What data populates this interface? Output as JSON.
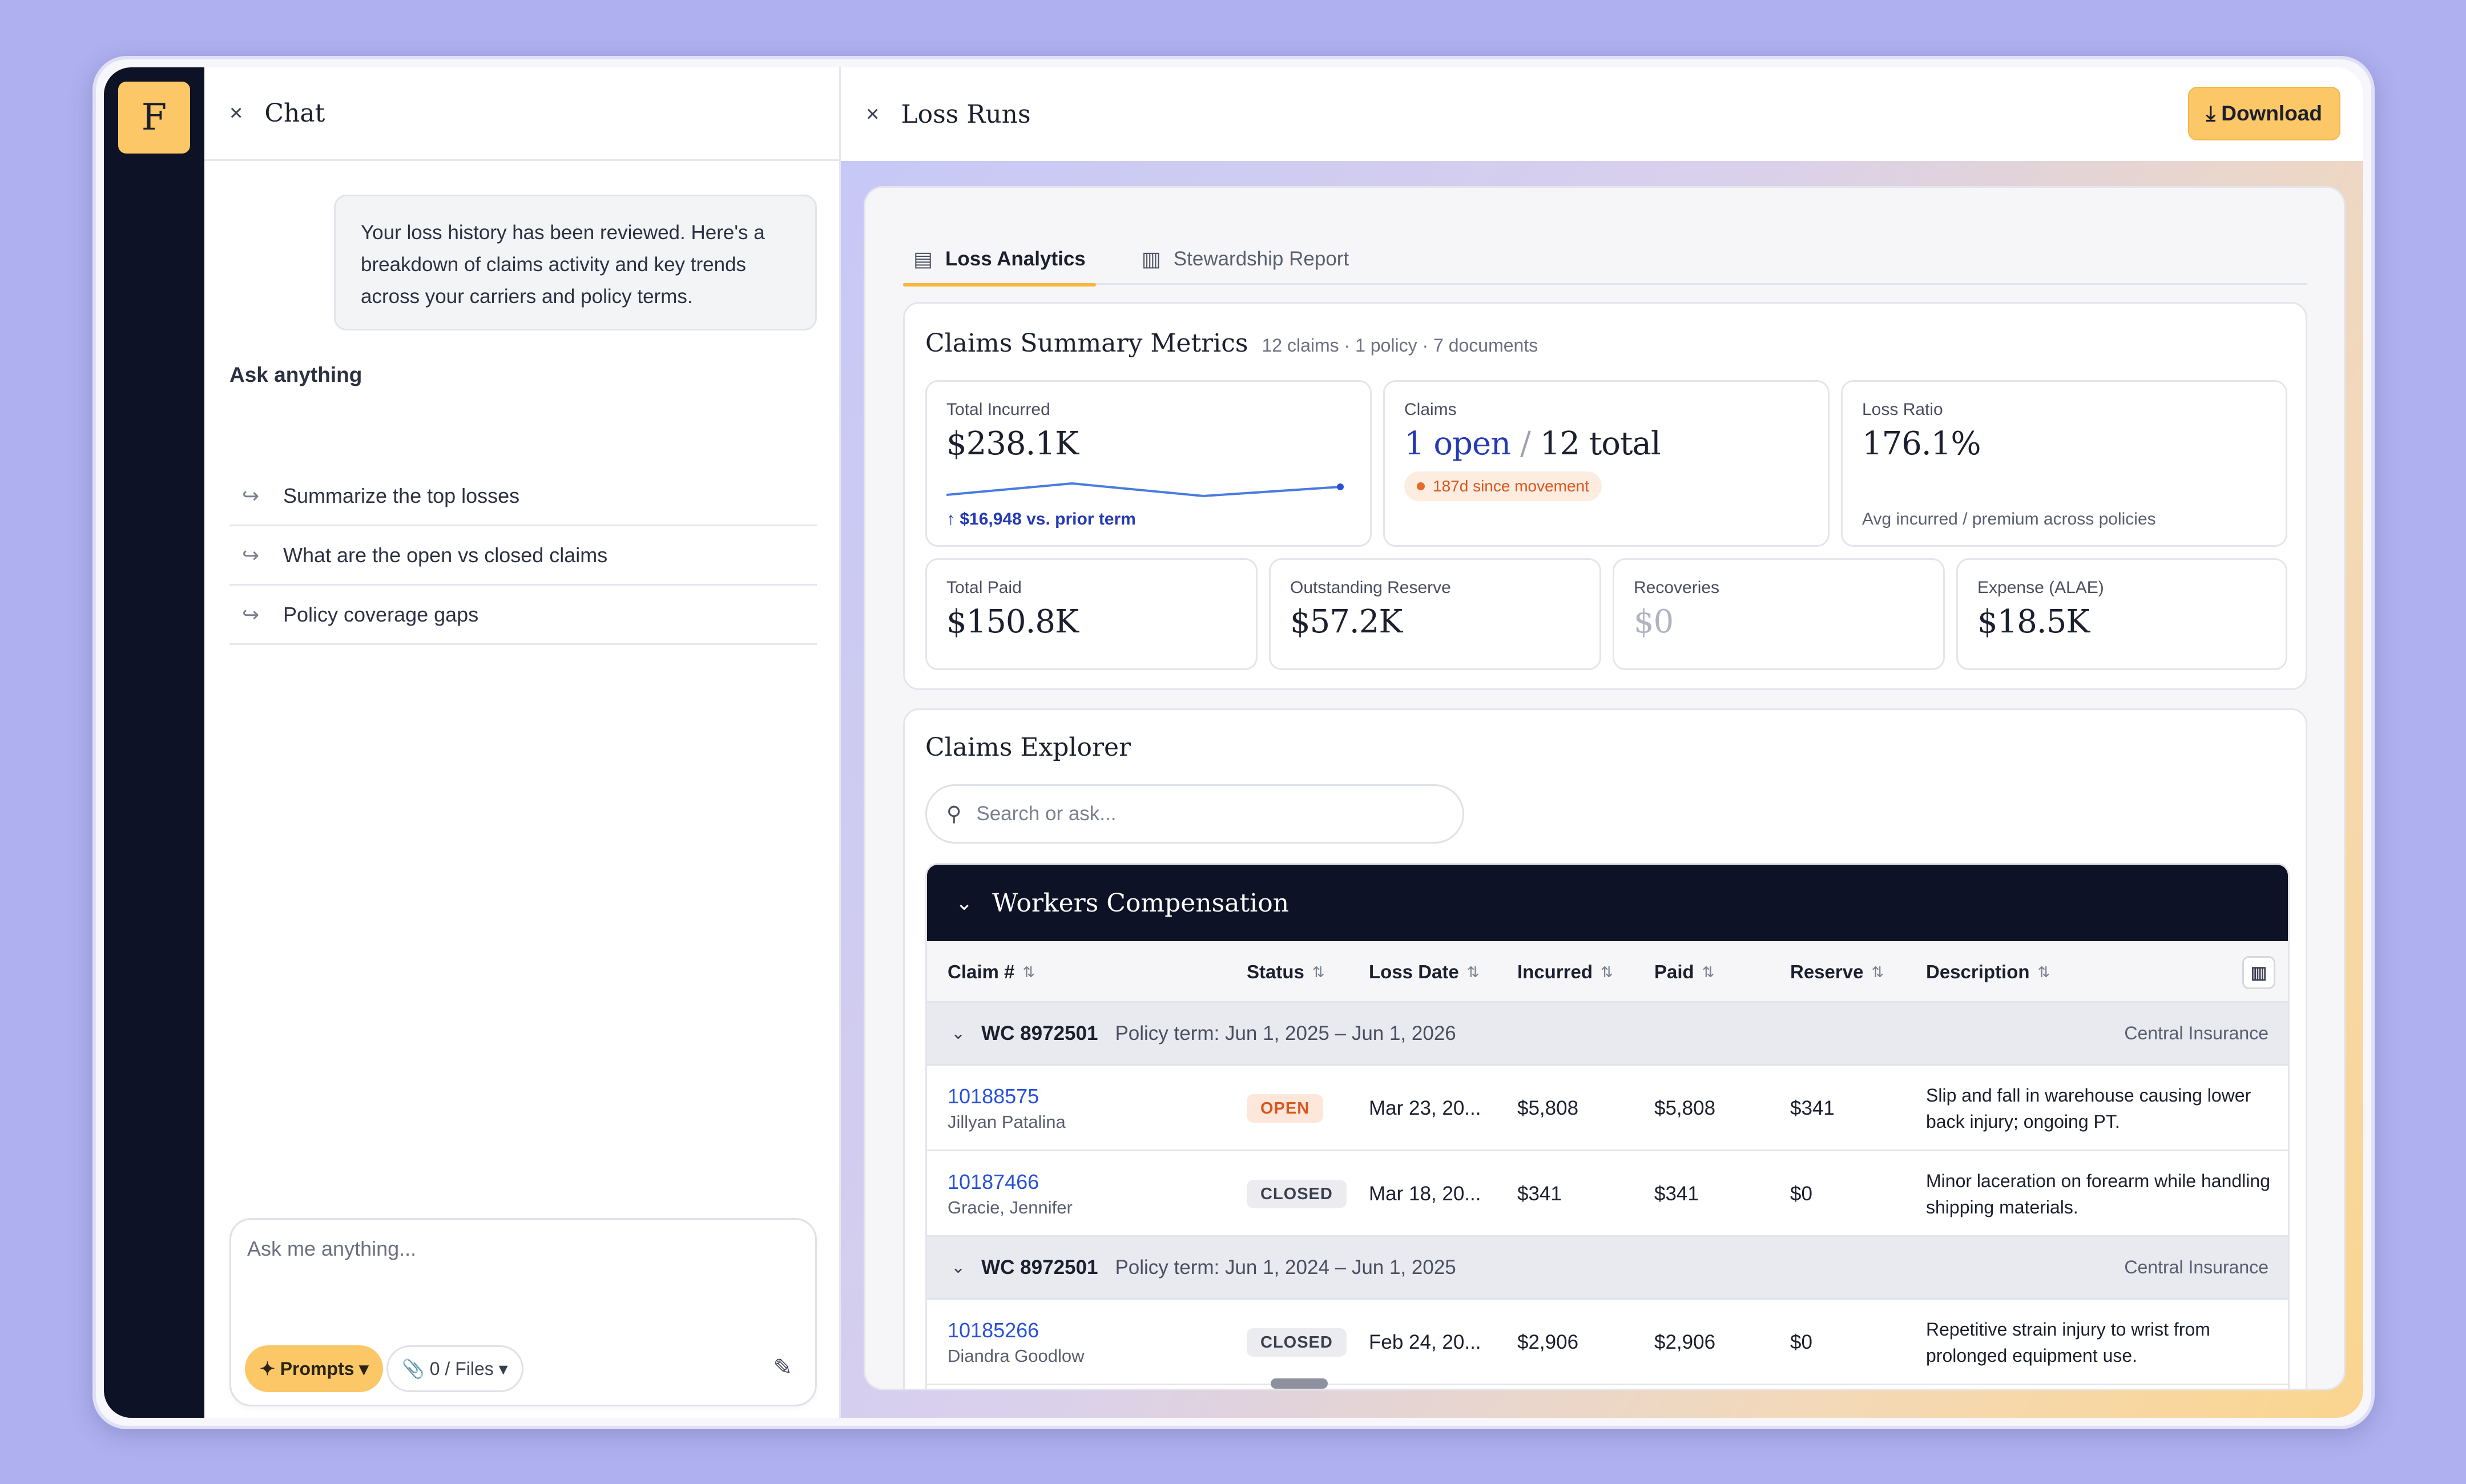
{
  "app": {
    "logo_letter": "F"
  },
  "chat": {
    "title": "Chat",
    "message": "Your loss history has been reviewed. Here's a breakdown of claims activity and key trends across your carriers and policy terms.",
    "ask_title": "Ask anything",
    "suggestions": [
      "Summarize the top losses",
      "What are the open vs closed claims",
      "Policy coverage gaps"
    ],
    "composer_placeholder": "Ask me anything...",
    "prompts_label": "✦ Prompts ▾",
    "files_label": "📎 0 / Files ▾"
  },
  "loss": {
    "title": "Loss Runs",
    "download_label": "⤓ Download",
    "tabs": [
      {
        "label": "Loss Analytics",
        "active": true
      },
      {
        "label": "Stewardship Report",
        "active": false
      }
    ],
    "summary": {
      "title": "Claims Summary Metrics",
      "subtitle": "12 claims · 1 policy · 7 documents",
      "total_incurred": {
        "label": "Total Incurred",
        "value": "$238.1K",
        "trend": "↑ $16,948 vs. prior term"
      },
      "claims": {
        "label": "Claims",
        "open": "1 open",
        "sep": "/",
        "total": "12 total",
        "badge": "187d since movement"
      },
      "loss_ratio": {
        "label": "Loss Ratio",
        "value": "176.1%",
        "note": "Avg incurred / premium across policies"
      },
      "total_paid": {
        "label": "Total Paid",
        "value": "$150.8K"
      },
      "outstanding": {
        "label": "Outstanding Reserve",
        "value": "$57.2K"
      },
      "recoveries": {
        "label": "Recoveries",
        "value": "$0"
      },
      "expense": {
        "label": "Expense (ALAE)",
        "value": "$18.5K"
      }
    },
    "explorer": {
      "title": "Claims Explorer",
      "search_placeholder": "Search or ask...",
      "group_title": "Workers Compensation",
      "columns": [
        "Claim #",
        "Status",
        "Loss Date",
        "Incurred",
        "Paid",
        "Reserve",
        "Description"
      ],
      "policies": [
        {
          "id": "WC 8972501",
          "term": "Policy term: Jun 1, 2025 – Jun 1, 2026",
          "carrier": "Central Insurance",
          "claims": [
            {
              "id": "10188575",
              "claimant": "Jillyan Patalina",
              "status": "OPEN",
              "loss_date": "Mar 23, 20...",
              "incurred": "$5,808",
              "paid": "$5,808",
              "reserve": "$341",
              "description": "Slip and fall in warehouse causing lower back injury; ongoing PT."
            },
            {
              "id": "10187466",
              "claimant": "Gracie, Jennifer",
              "status": "CLOSED",
              "loss_date": "Mar 18, 20...",
              "incurred": "$341",
              "paid": "$341",
              "reserve": "$0",
              "description": "Minor laceration on forearm while handling shipping materials."
            }
          ]
        },
        {
          "id": "WC 8972501",
          "term": "Policy term: Jun 1, 2024 – Jun 1, 2025",
          "carrier": "Central Insurance",
          "claims": [
            {
              "id": "10185266",
              "claimant": "Diandra Goodlow",
              "status": "CLOSED",
              "loss_date": "Feb 24, 20...",
              "incurred": "$2,906",
              "paid": "$2,906",
              "reserve": "$0",
              "description": "Repetitive strain injury to wrist from prolonged equipment use."
            }
          ]
        }
      ]
    }
  },
  "colors": {
    "accent": "#fcc766",
    "rail": "#0e1226",
    "link": "#2851d6",
    "open": "#d9571e"
  }
}
